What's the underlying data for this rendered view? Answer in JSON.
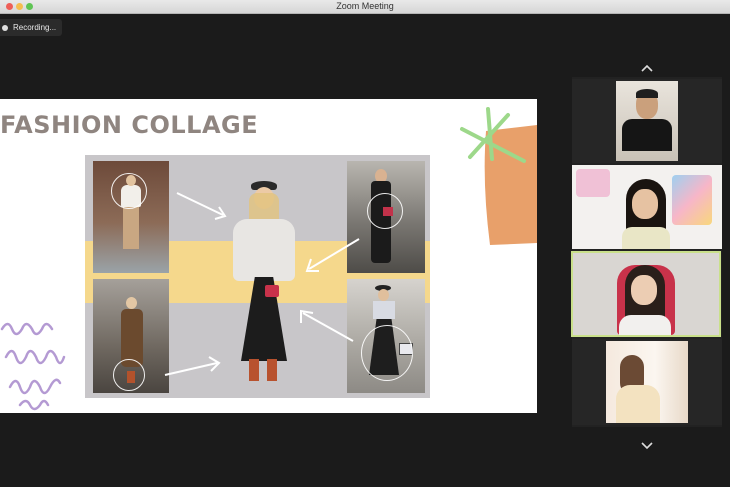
{
  "window": {
    "title": "Zoom Meeting"
  },
  "recording": {
    "label": "Recording..."
  },
  "slide": {
    "title": "FASHION COLLAGE"
  },
  "colors": {
    "band": "#f5d88c",
    "collage_bg": "#c8c6c9",
    "accent_orange": "#e8a06a",
    "accent_green": "#9dd88a",
    "accent_purple": "#b49ad3",
    "active_speaker_border": "#c9e08a"
  },
  "participants": {
    "count_visible": 4
  },
  "icons": {
    "scroll_up": "chevron-up-icon",
    "scroll_down": "chevron-down-icon"
  }
}
